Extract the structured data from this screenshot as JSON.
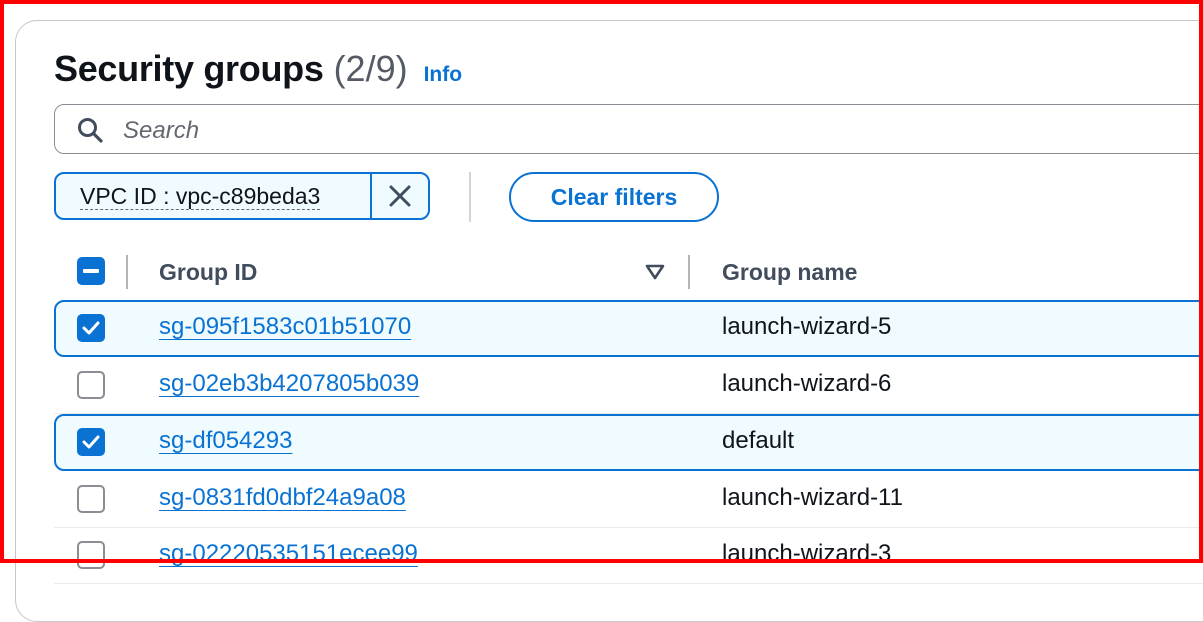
{
  "header": {
    "title": "Security groups",
    "count": "(2/9)",
    "info_label": "Info"
  },
  "search": {
    "placeholder": "Search",
    "value": ""
  },
  "filters": {
    "token_label": "VPC ID : vpc-c89beda3",
    "clear_label": "Clear filters"
  },
  "table": {
    "columns": [
      "Group ID",
      "Group name"
    ],
    "sort_icon": "caret-down-icon",
    "rows": [
      {
        "id": "sg-095f1583c01b51070",
        "name": "launch-wizard-5",
        "checked": true
      },
      {
        "id": "sg-02eb3b4207805b039",
        "name": "launch-wizard-6",
        "checked": false
      },
      {
        "id": "sg-df054293",
        "name": "default",
        "checked": true
      },
      {
        "id": "sg-0831fd0dbf24a9a08",
        "name": "launch-wizard-11",
        "checked": false
      },
      {
        "id": "sg-02220535151ecee99",
        "name": "launch-wizard-3",
        "checked": false
      }
    ]
  },
  "colors": {
    "accent": "#0972d3",
    "selected_bg": "#f0fbff",
    "frame": "#ff0000"
  }
}
